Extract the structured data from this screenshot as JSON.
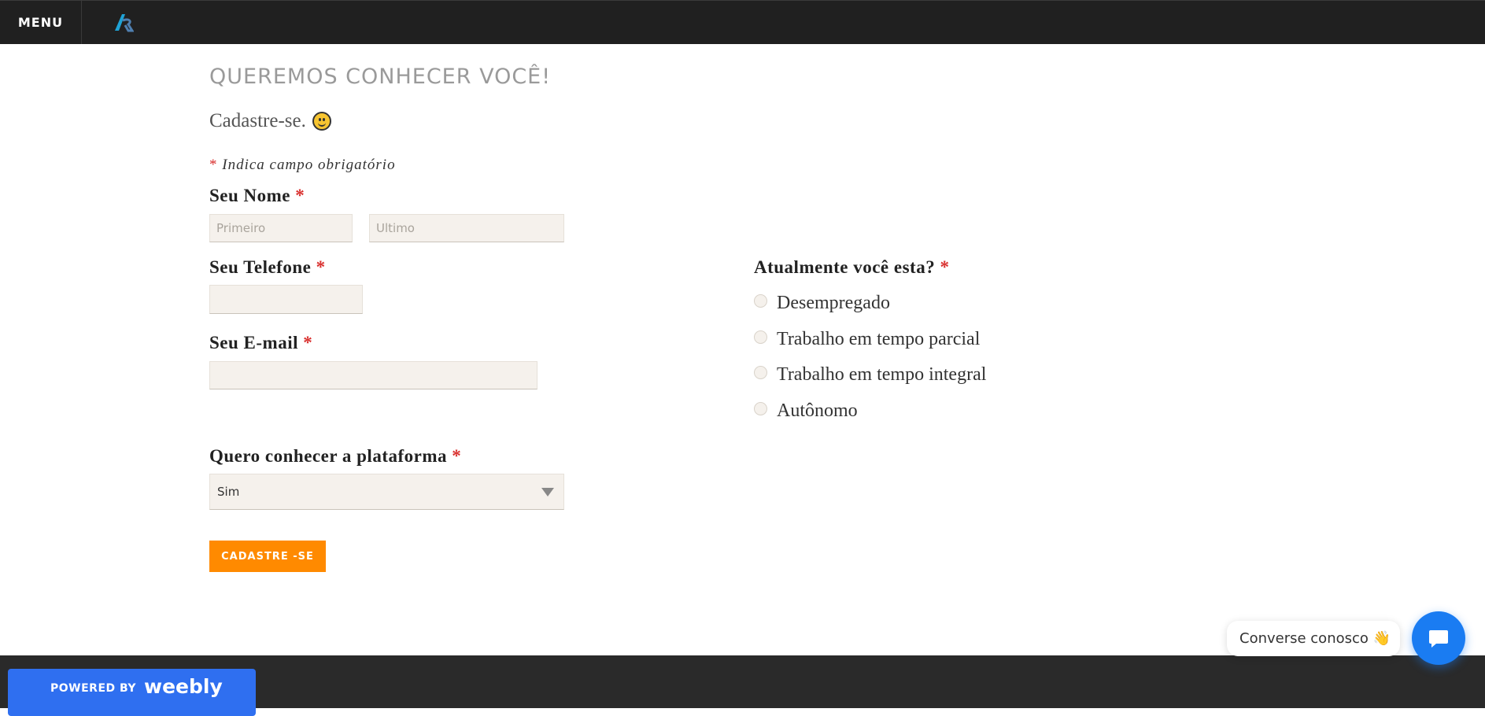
{
  "topbar": {
    "menu_label": "MENU",
    "logo_icon": "ar-logo-icon"
  },
  "page": {
    "title": "QUEREMOS CONHECER VOCÊ!",
    "subtitle": "Cadastre-se.",
    "required_note": "Indica campo obrigatório",
    "required_mark": "*"
  },
  "form": {
    "name": {
      "label": "Seu Nome",
      "first_placeholder": "Primeiro",
      "last_placeholder": "Ultimo"
    },
    "phone": {
      "label": "Seu Telefone",
      "value": ""
    },
    "email": {
      "label": "Seu E-mail",
      "value": ""
    },
    "platform": {
      "label": "Quero conhecer a plataforma",
      "selected": "Sim"
    },
    "status": {
      "label": "Atualmente você esta?",
      "options": [
        "Desempregado",
        "Trabalho em tempo parcial",
        "Trabalho em tempo integral",
        "Autônomo"
      ]
    },
    "submit_label": "CADASTRE -SE"
  },
  "footer": {
    "powered_by": "POWERED BY",
    "brand": "weebly"
  },
  "chat": {
    "bubble_text": "Converse conosco",
    "emoji": "👋"
  },
  "colors": {
    "accent": "#ff8a00",
    "required": "#d9302e",
    "topbar": "#202020",
    "chat": "#1a7cf2",
    "weebly": "#2f6ff0"
  }
}
